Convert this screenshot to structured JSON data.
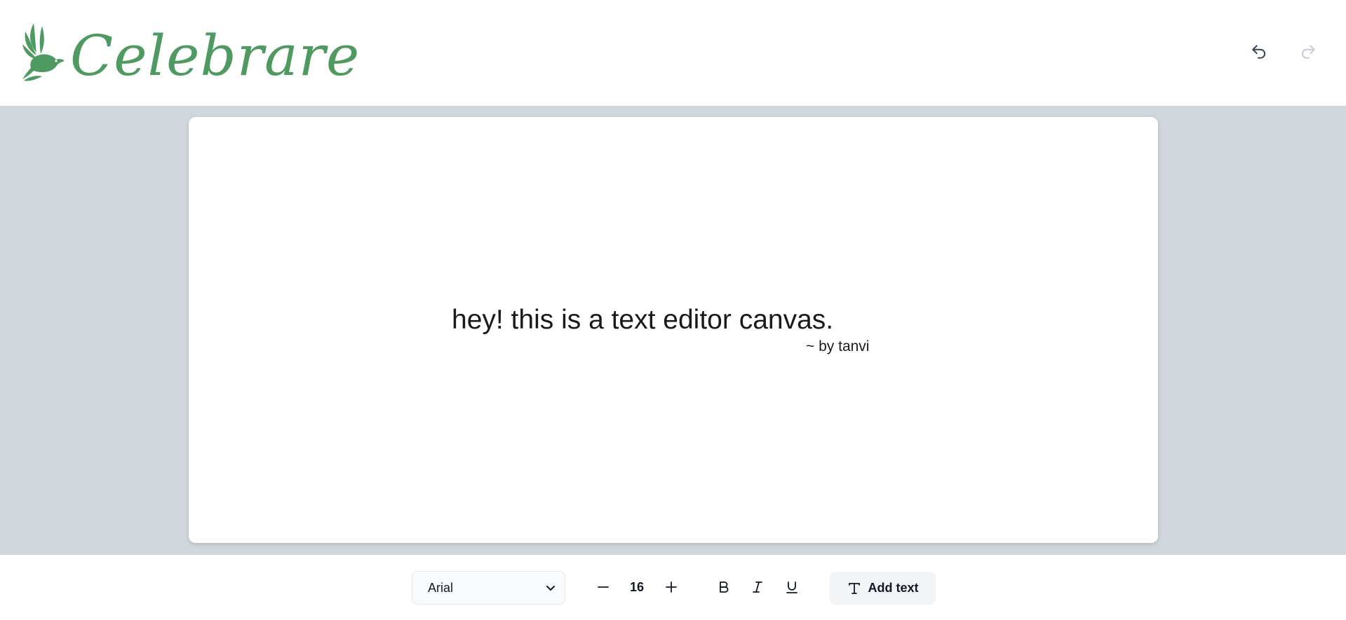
{
  "app": {
    "logo_text": "Celebrare",
    "brand_color": "#4f9a61"
  },
  "header": {
    "undo": {
      "icon": "undo-icon",
      "enabled": true
    },
    "redo": {
      "icon": "redo-icon",
      "enabled": false
    }
  },
  "canvas": {
    "texts": [
      {
        "content": "hey! this is a text editor canvas."
      },
      {
        "content": "~ by tanvi"
      }
    ]
  },
  "toolbar": {
    "font_family": {
      "selected": "Arial"
    },
    "font_size": {
      "value": "16",
      "decrease_icon": "minus-icon",
      "increase_icon": "plus-icon"
    },
    "bold_icon": "bold-icon",
    "italic_icon": "italic-icon",
    "underline_icon": "underline-icon",
    "add_text_label": "Add text",
    "add_text_icon": "type-icon"
  }
}
